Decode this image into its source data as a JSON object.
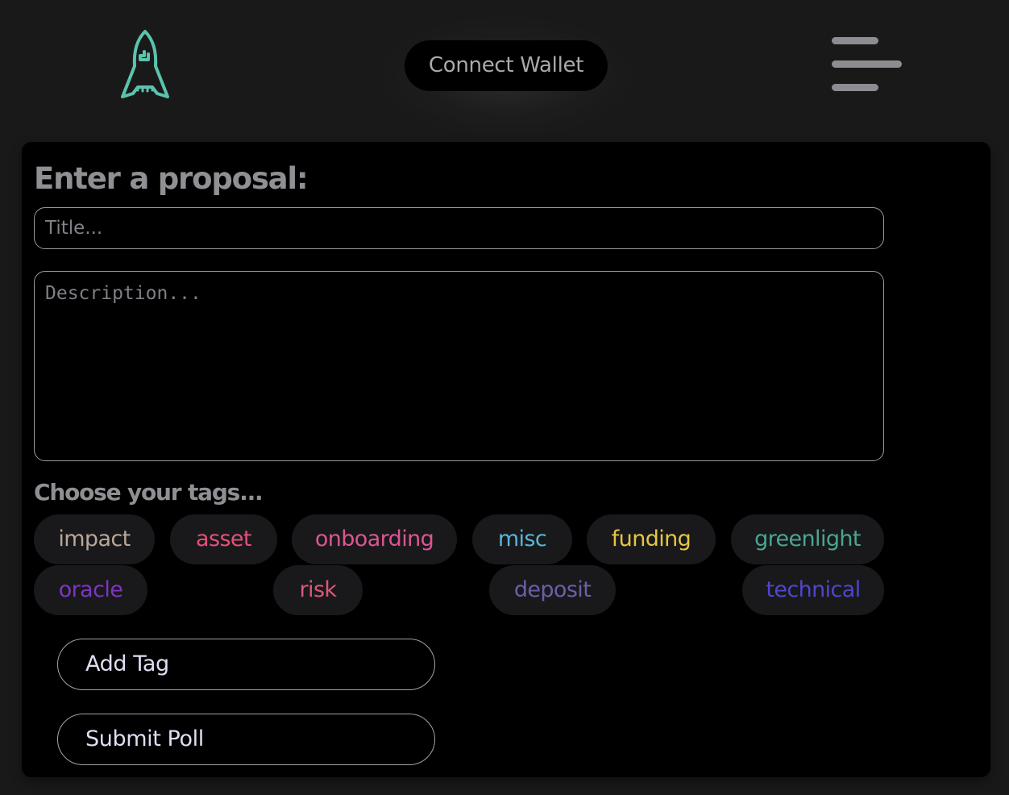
{
  "header": {
    "logo_icon": "rocket-icon",
    "logo_color": "#5bc3ad",
    "connect_label": "Connect Wallet",
    "menu_icon": "hamburger-menu-icon"
  },
  "form": {
    "heading": "Enter a proposal:",
    "title_placeholder": "Title...",
    "title_value": "",
    "description_placeholder": "Description...",
    "description_value": "",
    "tags_heading": "Choose your tags...",
    "tags": [
      {
        "label": "impact",
        "color": "#b7a899"
      },
      {
        "label": "asset",
        "color": "#e4507a"
      },
      {
        "label": "onboarding",
        "color": "#dc5593"
      },
      {
        "label": "misc",
        "color": "#58b6d8"
      },
      {
        "label": "funding",
        "color": "#e6c640"
      },
      {
        "label": "greenlight",
        "color": "#4aa592"
      },
      {
        "label": "oracle",
        "color": "#7f35c1"
      },
      {
        "label": "risk",
        "color": "#dc5779"
      },
      {
        "label": "deposit",
        "color": "#6a5fa8"
      },
      {
        "label": "technical",
        "color": "#4f45cf"
      }
    ],
    "add_tag_label": "Add Tag",
    "submit_label": "Submit Poll"
  }
}
